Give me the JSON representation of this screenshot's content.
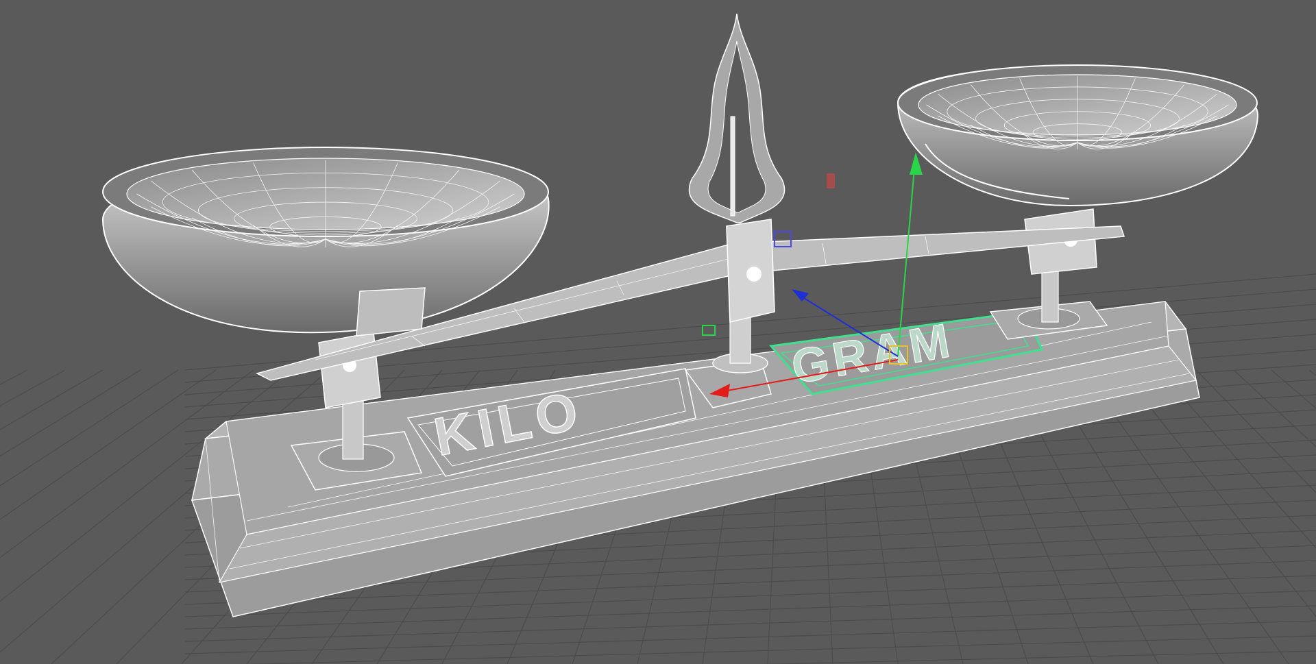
{
  "viewport": {
    "background": "#5a5a5a",
    "grid_color": "#4a4a4a",
    "wire_color": "#ffffff",
    "selection_color": "#3fe08f"
  },
  "model": {
    "engraving_left": "KILO",
    "engraving_right": "GRAM"
  },
  "gizmo": {
    "x_axis_color": "#e41b1b",
    "y_axis_color": "#28d64a",
    "z_axis_color": "#1f2fd6",
    "pivot_color": "#e6c22a"
  }
}
